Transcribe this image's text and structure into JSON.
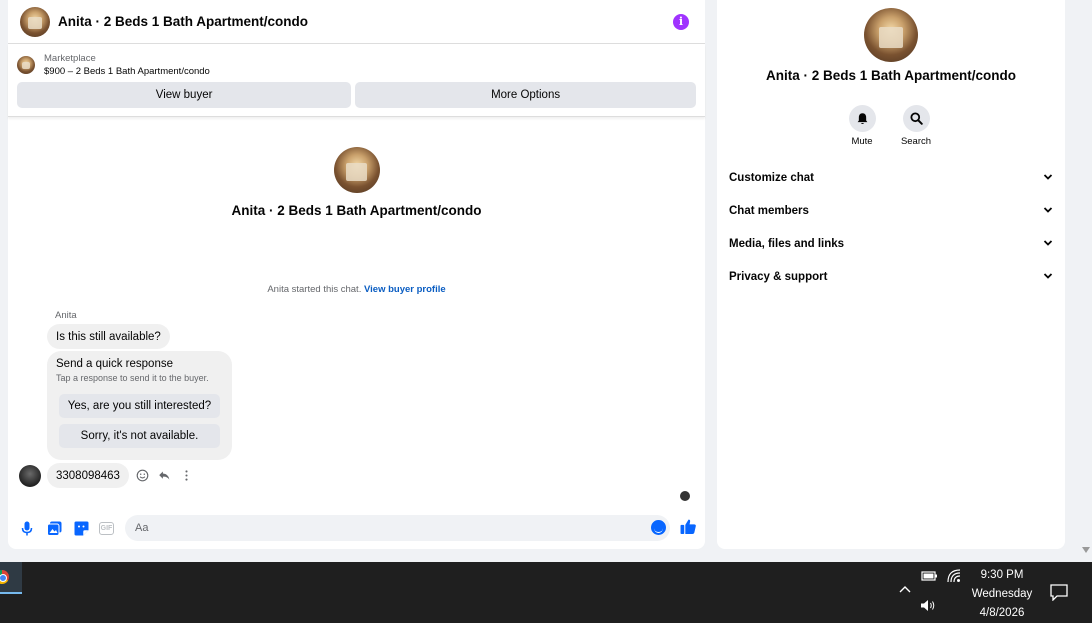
{
  "chat": {
    "title": "Anita · 2 Beds 1 Bath Apartment/condo",
    "listing": {
      "source": "Marketplace",
      "price_title": "$900 – 2 Beds 1 Bath Apartment/condo",
      "view_buyer": "View buyer",
      "more_options": "More Options"
    },
    "intro_name": "Anita · 2 Beds 1 Bath Apartment/condo",
    "started_text": "Anita started this chat.",
    "started_link": "View buyer profile",
    "sender": "Anita",
    "message_1": "Is this still available?",
    "quick_response": {
      "title": "Send a quick response",
      "subtitle": "Tap a response to send it to the buyer.",
      "option_1": "Yes, are you still interested?",
      "option_2": "Sorry, it's not available."
    },
    "message_2": "3308098463",
    "composer_placeholder": "Aa"
  },
  "info": {
    "name": "Anita · 2 Beds 1 Bath Apartment/condo",
    "mute": "Mute",
    "search": "Search",
    "sections": [
      "Customize chat",
      "Chat members",
      "Media, files and links",
      "Privacy & support"
    ]
  },
  "taskbar": {
    "time": "9:30 PM",
    "day": "Wednesday",
    "date": "4/8/2026"
  },
  "colors": {
    "accent": "#0866ff",
    "info_icon": "#a033ff",
    "link": "#0a5dc2"
  }
}
